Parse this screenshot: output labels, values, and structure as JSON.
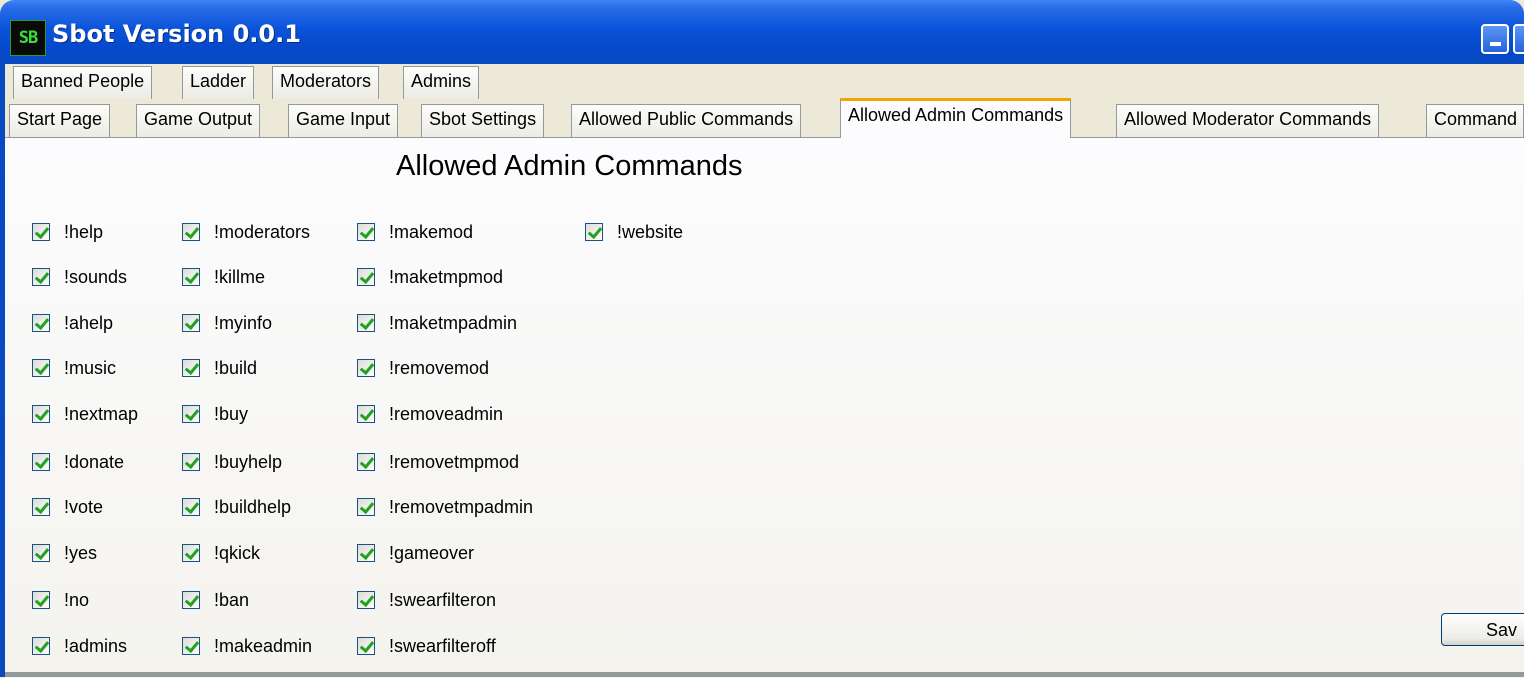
{
  "window": {
    "title": "Sbot Version 0.0.1",
    "icon_text": "SB"
  },
  "tabs_row1": [
    "Banned People",
    "Ladder",
    "Moderators",
    "Admins"
  ],
  "tabs_row2": [
    "Start Page",
    "Game Output",
    "Game Input",
    "Sbot Settings",
    "Allowed Public Commands",
    "Allowed Admin Commands",
    "Allowed Moderator Commands",
    "Command"
  ],
  "active_tab": "Allowed Admin Commands",
  "page": {
    "heading": "Allowed Admin Commands"
  },
  "commands": {
    "col1": [
      "!help",
      "!sounds",
      "!ahelp",
      "!music",
      "!nextmap",
      "!donate",
      "!vote",
      "!yes",
      "!no",
      "!admins"
    ],
    "col2": [
      "!moderators",
      "!killme",
      "!myinfo",
      "!build",
      "!buy",
      "!buyhelp",
      "!buildhelp",
      "!qkick",
      "!ban",
      "!makeadmin"
    ],
    "col3": [
      "!makemod",
      "!maketmpmod",
      "!maketmpadmin",
      "!removemod",
      "!removeadmin",
      "!removetmpmod",
      "!removetmpadmin",
      "!gameover",
      "!swearfilteron",
      "!swearfilteroff"
    ],
    "col4": [
      "!website"
    ]
  },
  "all_checked": true,
  "save_label": "Sav"
}
